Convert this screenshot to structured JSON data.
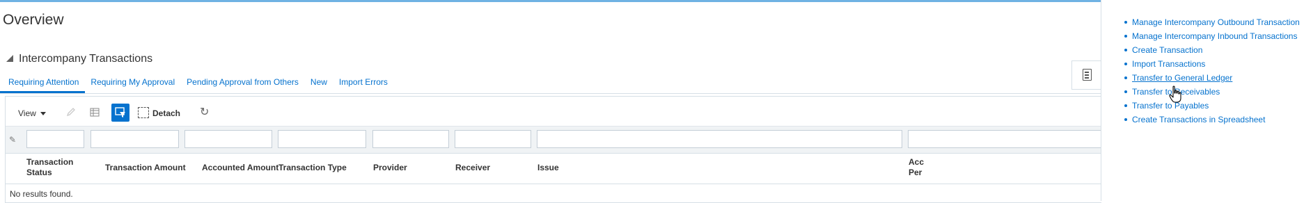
{
  "page": {
    "title": "Overview"
  },
  "section": {
    "title": "Intercompany Transactions"
  },
  "tabs": [
    {
      "label": "Requiring Attention",
      "active": true
    },
    {
      "label": "Requiring My Approval"
    },
    {
      "label": "Pending Approval from Others"
    },
    {
      "label": "New"
    },
    {
      "label": "Import Errors"
    }
  ],
  "toolbar": {
    "view_label": "View",
    "detach_label": "Detach"
  },
  "table": {
    "columns": [
      "Transaction Status",
      "Transaction Amount",
      "Accounted Amount",
      "Transaction Type",
      "Provider",
      "Receiver",
      "Issue",
      "Acc Per"
    ],
    "empty_message": "No results found."
  },
  "tasks": [
    {
      "label": "Manage Intercompany Outbound Transaction"
    },
    {
      "label": "Manage Intercompany Inbound Transactions"
    },
    {
      "label": "Create Transaction"
    },
    {
      "label": "Import Transactions"
    },
    {
      "label": "Transfer to General Ledger",
      "hovered": true
    },
    {
      "label": "Transfer to Receivables"
    },
    {
      "label": "Transfer to Payables"
    },
    {
      "label": "Create Transactions in Spreadsheet"
    }
  ],
  "colors": {
    "accent": "#0572ce",
    "border": "#d6dfe6",
    "topline": "#6fb2e3"
  }
}
